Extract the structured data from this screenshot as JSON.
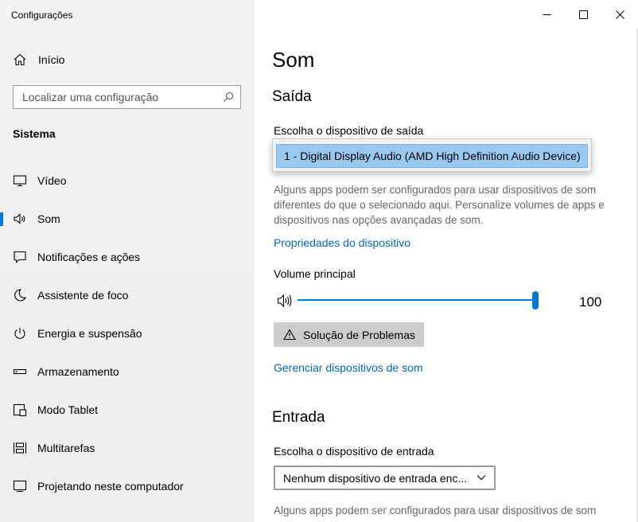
{
  "app": {
    "title": "Configurações"
  },
  "sidebar": {
    "home_label": "Início",
    "search_placeholder": "Localizar uma configuração",
    "section_label": "Sistema",
    "items": [
      {
        "label": "Vídeo",
        "icon": "monitor-icon"
      },
      {
        "label": "Som",
        "icon": "speaker-icon",
        "active": true
      },
      {
        "label": "Notificações e ações",
        "icon": "notification-icon"
      },
      {
        "label": "Assistente de foco",
        "icon": "moon-icon"
      },
      {
        "label": "Energia e suspensão",
        "icon": "power-icon"
      },
      {
        "label": "Armazenamento",
        "icon": "storage-icon"
      },
      {
        "label": "Modo Tablet",
        "icon": "tablet-icon"
      },
      {
        "label": "Multitarefas",
        "icon": "multitask-icon"
      },
      {
        "label": "Projetando neste computador",
        "icon": "projecting-icon"
      }
    ]
  },
  "main": {
    "title": "Som",
    "output": {
      "heading": "Saída",
      "choose_label": "Escolha o dispositivo de saída",
      "selected_device": "1 - Digital Display Audio (AMD High Definition Audio Device)",
      "description": "Alguns apps podem ser configurados para usar dispositivos de som diferentes do que o selecionado aqui. Personalize volumes de apps e dispositivos nas opções avançadas de som.",
      "device_properties_link": "Propriedades do dispositivo",
      "volume_label": "Volume principal",
      "volume_value": "100",
      "volume_level": 1.0,
      "troubleshoot_button": "Solução de Problemas",
      "manage_devices_link": "Gerenciar dispositivos de som"
    },
    "input": {
      "heading": "Entrada",
      "choose_label": "Escolha o dispositivo de entrada",
      "selected_device": "Nenhum dispositivo de entrada enc...",
      "description": "Alguns apps podem ser configurados para usar dispositivos de som"
    }
  },
  "colors": {
    "accent": "#0078d7",
    "link": "#0067c0",
    "selection": "#99c9ef"
  }
}
